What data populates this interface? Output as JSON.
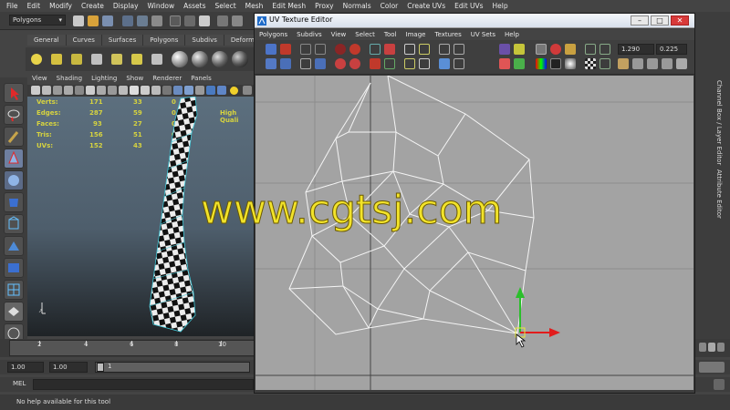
{
  "menubar": [
    "File",
    "Edit",
    "Modify",
    "Create",
    "Display",
    "Window",
    "Assets",
    "Select",
    "Mesh",
    "Edit Mesh",
    "Proxy",
    "Normals",
    "Color",
    "Create UVs",
    "Edit UVs",
    "Help"
  ],
  "status": {
    "mode": "Polygons"
  },
  "shelf": {
    "tabs": [
      "General",
      "Curves",
      "Surfaces",
      "Polygons",
      "Subdivs",
      "Deformation"
    ]
  },
  "viewport": {
    "menu": [
      "View",
      "Shading",
      "Lighting",
      "Show",
      "Renderer",
      "Panels"
    ],
    "hud": {
      "rows": [
        {
          "label": "Verts:",
          "a": "171",
          "b": "33",
          "c": "0"
        },
        {
          "label": "Edges:",
          "a": "287",
          "b": "59",
          "c": "0"
        },
        {
          "label": "Faces:",
          "a": "93",
          "b": "27",
          "c": "0"
        },
        {
          "label": "Tris:",
          "a": "156",
          "b": "51",
          "c": "0"
        },
        {
          "label": "UVs:",
          "a": "152",
          "b": "43",
          "c": "0"
        }
      ],
      "quality": "High Quali"
    }
  },
  "timeline": {
    "ticks": [
      "2",
      "4",
      "6",
      "8",
      "10"
    ]
  },
  "range": {
    "start": "1.00",
    "current": "1.00",
    "current_frame": "1"
  },
  "mel": {
    "label": "MEL"
  },
  "help": {
    "text": "No help available for this tool"
  },
  "right_tabs": [
    "Channel Box / Layer Editor",
    "Attribute Editor"
  ],
  "uv_editor": {
    "title": "UV Texture Editor",
    "menu": [
      "Polygons",
      "Subdivs",
      "View",
      "Select",
      "Tool",
      "Image",
      "Textures",
      "UV Sets",
      "Help"
    ],
    "field_u": "1.290",
    "field_v": "0.225"
  },
  "watermark": "www.cgtsj.com",
  "colors": {
    "accent": "#d6d33f",
    "manip_x": "#e21c1c",
    "manip_y": "#2bbf2b",
    "watermark": "#f2e32a"
  }
}
